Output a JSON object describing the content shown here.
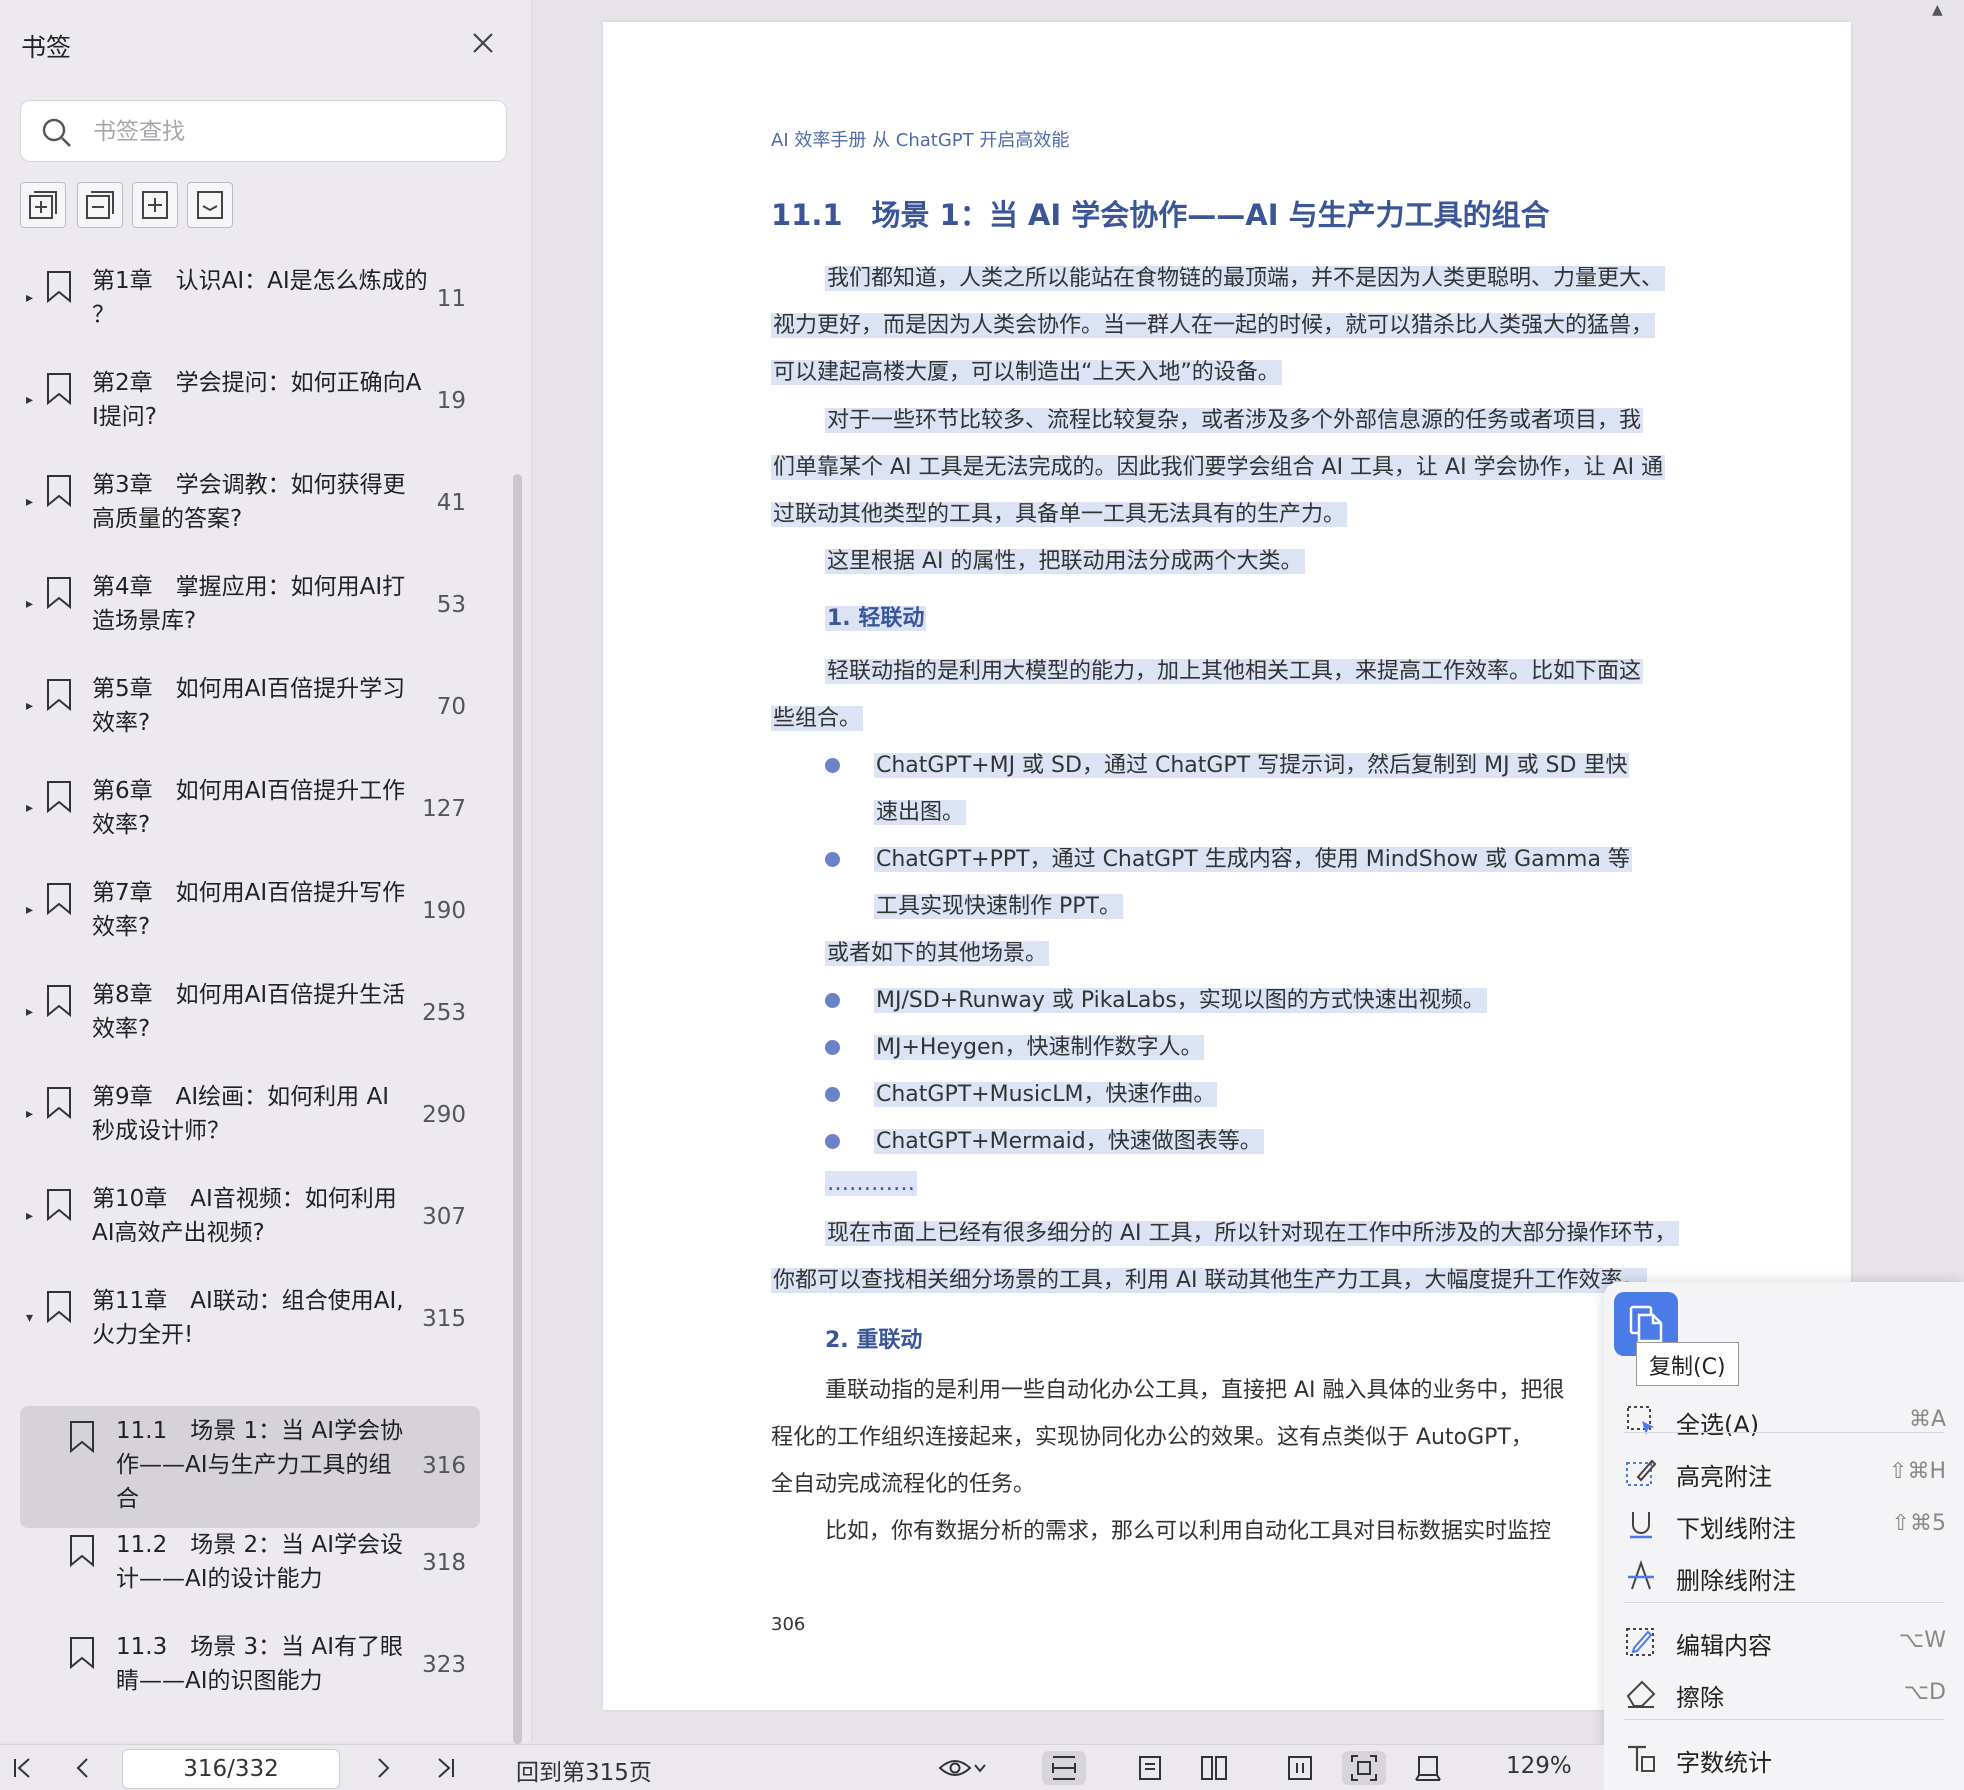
{
  "sidebar": {
    "title": "书签",
    "search_placeholder": "书签查找",
    "bookmarks": [
      {
        "label_lines": [
          "第1章　认识AI：AI是怎么炼成的",
          "？"
        ],
        "page": "11"
      },
      {
        "label_lines": [
          "第2章　学会提问：如何正确向A",
          "I提问?"
        ],
        "page": "19"
      },
      {
        "label_lines": [
          "第3章　学会调教：如何获得更",
          "高质量的答案?"
        ],
        "page": "41"
      },
      {
        "label_lines": [
          "第4章　掌握应用：如何用AI打",
          "造场景库?"
        ],
        "page": "53"
      },
      {
        "label_lines": [
          "第5章　如何用AI百倍提升学习",
          "效率?"
        ],
        "page": "70"
      },
      {
        "label_lines": [
          "第6章　如何用AI百倍提升工作",
          "效率?"
        ],
        "page": "127"
      },
      {
        "label_lines": [
          "第7章　如何用AI百倍提升写作",
          "效率?"
        ],
        "page": "190"
      },
      {
        "label_lines": [
          "第8章　如何用AI百倍提升生活",
          "效率?"
        ],
        "page": "253"
      },
      {
        "label_lines": [
          "第9章　AI绘画：如何利用 AI",
          "秒成设计师？"
        ],
        "page": "290"
      },
      {
        "label_lines": [
          "第10章　AI音视频：如何利用",
          "AI高效产出视频?"
        ],
        "page": "307"
      },
      {
        "label_lines": [
          "第11章　AI联动：组合使用AI,",
          "火力全开!"
        ],
        "page": "315"
      },
      {
        "label_lines": [
          "11.1　场景 1：当 AI学会协",
          "作——AI与生产力工具的组",
          "合"
        ],
        "page": "316"
      },
      {
        "label_lines": [
          "11.2　场景 2：当 AI学会设",
          "计——AI的设计能力"
        ],
        "page": "318"
      },
      {
        "label_lines": [
          "11.3　场景 3：当 AI有了眼",
          "睛——AI的识图能力"
        ],
        "page": "323"
      }
    ]
  },
  "document": {
    "header": "AI 效率手册  从 ChatGPT 开启高效能",
    "section_title": "11.1　场景 1：当 AI 学会协作——AI 与生产力工具的组合",
    "lines": {
      "p1a": "我们都知道，人类之所以能站在食物链的最顶端，并不是因为人类更聪明、力量更大、",
      "p1b": "视力更好，而是因为人类会协作。当一群人在一起的时候，就可以猎杀比人类强大的猛兽，",
      "p1c": "可以建起高楼大厦，可以制造出“上天入地”的设备。",
      "p2a": "对于一些环节比较多、流程比较复杂，或者涉及多个外部信息源的任务或者项目，我",
      "p2b": "们单靠某个 AI 工具是无法完成的。因此我们要学会组合 AI 工具，让 AI 学会协作，让 AI 通",
      "p2c": "过联动其他类型的工具，具备单一工具无法具有的生产力。",
      "p3": "这里根据 AI 的属性，把联动用法分成两个大类。",
      "h_light": "1. 轻联动",
      "p4a": "轻联动指的是利用大模型的能力，加上其他相关工具，来提高工作效率。比如下面这",
      "p4b": "些组合。",
      "b1a": "ChatGPT+MJ 或 SD，通过 ChatGPT 写提示词，然后复制到 MJ 或 SD 里快",
      "b1b": "速出图。",
      "b2a": "ChatGPT+PPT，通过 ChatGPT 生成内容，使用 MindShow 或 Gamma 等",
      "b2b": "工具实现快速制作 PPT。",
      "p5": "或者如下的其他场景。",
      "b3": "MJ/SD+Runway 或 PikaLabs，实现以图的方式快速出视频。",
      "b4": "MJ+Heygen，快速制作数字人。",
      "b5": "ChatGPT+MusicLM，快速作曲。",
      "b6": "ChatGPT+Mermaid，快速做图表等。",
      "dots": "…………",
      "p6a": "现在市面上已经有很多细分的 AI 工具，所以针对现在工作中所涉及的大部分操作环节，",
      "p6b": "你都可以查找相关细分场景的工具，利用 AI 联动其他生产力工具，大幅度提升工作效率。",
      "h_heavy": "2. 重联动",
      "p7a": "重联动指的是利用一些自动化办公工具，直接把 AI 融入具体的业务中，把很",
      "p7b": "程化的工作组织连接起来，实现协同化办公的效果。这有点类似于 AutoGPT，",
      "p7c": "全自动完成流程化的任务。",
      "p8": "比如，你有数据分析的需求，那么可以利用自动化工具对目标数据实时监控"
    },
    "page_number": "306"
  },
  "context_menu": {
    "tooltip": "复制(C)",
    "items": [
      {
        "label": "全选(A)",
        "shortcut": "⌘A"
      },
      {
        "label": "高亮附注",
        "shortcut": "⇧⌘H"
      },
      {
        "label": "下划线附注",
        "shortcut": "⇧⌘5"
      },
      {
        "label": "删除线附注",
        "shortcut": ""
      },
      {
        "label": "编辑内容",
        "shortcut": "⌥W"
      },
      {
        "label": "擦除",
        "shortcut": "⌥D"
      },
      {
        "label": "字数统计",
        "shortcut": ""
      }
    ]
  },
  "toolbar": {
    "page_value": "316/332",
    "back_link": "回到第315页",
    "zoom": "129%"
  },
  "colors": {
    "accent": "#3a5698",
    "highlight": "#dbe3f4",
    "copy_button": "#4a7be6",
    "sidebar_bg": "#eceaee"
  }
}
